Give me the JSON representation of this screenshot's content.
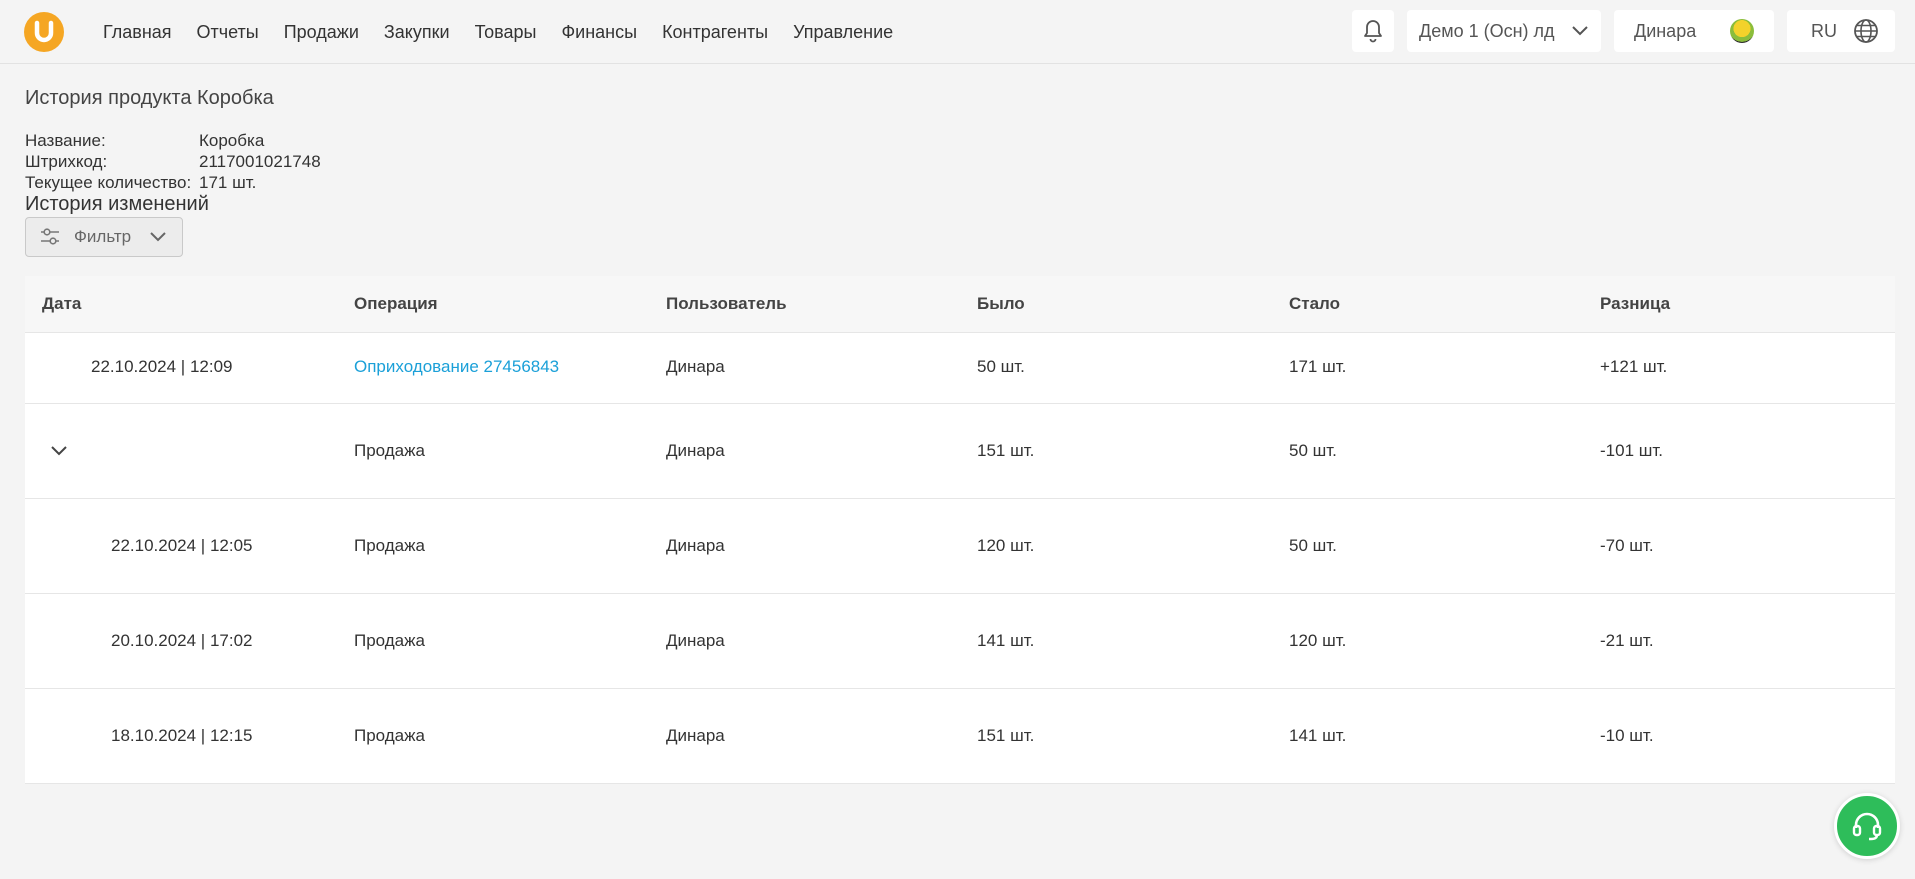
{
  "nav": [
    "Главная",
    "Отчеты",
    "Продажи",
    "Закупки",
    "Товары",
    "Финансы",
    "Контрагенты",
    "Управление"
  ],
  "header": {
    "company": "Демо 1 (Осн) лд",
    "user": "Динара",
    "language": "RU"
  },
  "page": {
    "title": "История продукта Коробка",
    "info": [
      {
        "label": "Название:",
        "value": "Коробка"
      },
      {
        "label": "Штрихкод:",
        "value": "2117001021748"
      },
      {
        "label": "Текущее количество:",
        "value": "171 шт."
      }
    ],
    "history_title": "История изменений",
    "filter_label": "Фильтр"
  },
  "table": {
    "columns": [
      "Дата",
      "Операция",
      "Пользователь",
      "Было",
      "Стало",
      "Разница"
    ],
    "rows": [
      {
        "date": "22.10.2024 | 12:09",
        "operation": "Оприходование 27456843",
        "is_link": true,
        "user": "Динара",
        "before": "50 шт.",
        "after": "171 шт.",
        "diff": "+121 шт."
      },
      {
        "date": "",
        "operation": "Продажа",
        "is_group": true,
        "user": "Динара",
        "before": "151 шт.",
        "after": "50 шт.",
        "diff": "-101 шт."
      },
      {
        "date": "22.10.2024 | 12:05",
        "operation": "Продажа",
        "user": "Динара",
        "before": "120 шт.",
        "after": "50 шт.",
        "diff": "-70 шт."
      },
      {
        "date": "20.10.2024 | 17:02",
        "operation": "Продажа",
        "user": "Динара",
        "before": "141 шт.",
        "after": "120 шт.",
        "diff": "-21 шт."
      },
      {
        "date": "18.10.2024 | 12:15",
        "operation": "Продажа",
        "user": "Динара",
        "before": "151 шт.",
        "after": "141 шт.",
        "diff": "-10 шт."
      }
    ]
  },
  "colors": {
    "accent": "#f5a623",
    "link": "#1ba0d8",
    "support": "#2ebd5a"
  },
  "icons": [
    "logo-u-icon",
    "bell-icon",
    "chevron-down-icon",
    "globe-icon",
    "sliders-icon",
    "headset-icon"
  ]
}
